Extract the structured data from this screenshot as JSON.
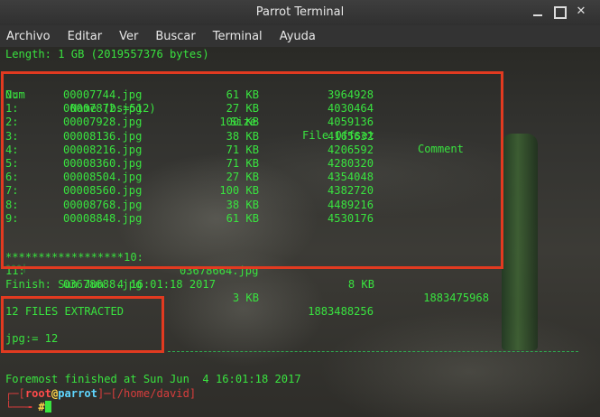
{
  "window": {
    "title": "Parrot Terminal",
    "menu": [
      "Archivo",
      "Editar",
      "Ver",
      "Buscar",
      "Terminal",
      "Ayuda"
    ]
  },
  "terminal": {
    "length_line": "Length: 1 GB (2019557376 bytes)",
    "headers": {
      "num": "Num",
      "name": "Name (bs=512)",
      "size": "Size",
      "offset": "File Offset",
      "comment": "Comment"
    },
    "rows": [
      {
        "num": "0:",
        "name": "00007744.jpg",
        "size": "61 KB",
        "offset": "3964928"
      },
      {
        "num": "1:",
        "name": "00007872.jpg",
        "size": "27 KB",
        "offset": "4030464"
      },
      {
        "num": "2:",
        "name": "00007928.jpg",
        "size": "100 KB",
        "offset": "4059136"
      },
      {
        "num": "3:",
        "name": "00008136.jpg",
        "size": "38 KB",
        "offset": "4165632"
      },
      {
        "num": "4:",
        "name": "00008216.jpg",
        "size": "71 KB",
        "offset": "4206592"
      },
      {
        "num": "5:",
        "name": "00008360.jpg",
        "size": "71 KB",
        "offset": "4280320"
      },
      {
        "num": "6:",
        "name": "00008504.jpg",
        "size": "27 KB",
        "offset": "4354048"
      },
      {
        "num": "7:",
        "name": "00008560.jpg",
        "size": "100 KB",
        "offset": "4382720"
      },
      {
        "num": "8:",
        "name": "00008768.jpg",
        "size": "38 KB",
        "offset": "4489216"
      },
      {
        "num": "9:",
        "name": "00008848.jpg",
        "size": "61 KB",
        "offset": "4530176"
      }
    ],
    "row10": {
      "prefix": "******************10:",
      "name": "03678664.jpg",
      "size": "8 KB",
      "offset": "1883475968"
    },
    "row11": {
      "num": "11:",
      "name": "03678688.jpg",
      "size": "3 KB",
      "offset": "1883488256"
    },
    "stars_line": "***|",
    "finish_line": "Finish: Sun Jun  4 16:01:18 2017",
    "files_extracted": "12 FILES EXTRACTED",
    "jpg_count": "jpg:= 12",
    "foremost_finished": "Foremost finished at Sun Jun  4 16:01:18 2017",
    "prompt": {
      "open": "┌─[",
      "user": "root",
      "at": "@",
      "host": "parrot",
      "middle": "]─[",
      "path": "/home/david",
      "close": "]",
      "second": "└──╼ ",
      "hash": "#"
    }
  },
  "colors": {
    "terminal_text": "#39e33f",
    "highlight_box": "#e23a20",
    "titlebar": "#3a3a3a"
  }
}
